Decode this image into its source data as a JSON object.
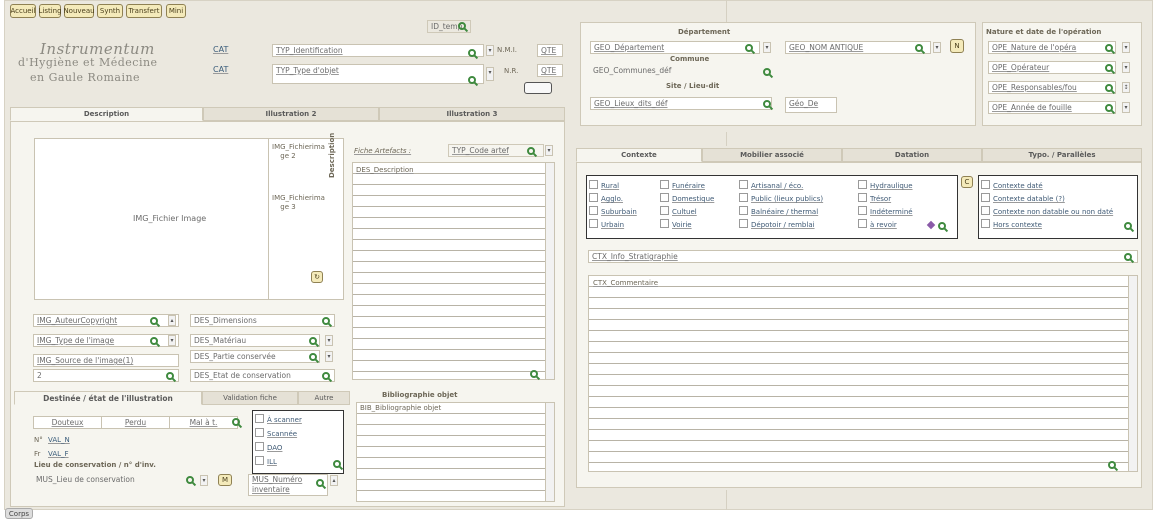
{
  "nav": [
    "Accueil",
    "Listing",
    "Nouveau",
    "Synth",
    "Transfert",
    "Mini"
  ],
  "search_id": "ID_temp",
  "brand": {
    "line1": "Instrumentum",
    "line2": "d'Hygiène et Médecine",
    "line3": "en Gaule Romaine"
  },
  "cat1": "CAT",
  "cat2": "CAT",
  "typ_ident": "TYP_Identification",
  "typ_type": "TYP_Type d'objet",
  "nmi_label": "N.M.I.",
  "nmi_value": "QTE",
  "nr_label": "N.R.",
  "nr_value": "QTE",
  "tabs_ill": [
    "Description",
    "Illustration 2",
    "Illustration 3"
  ],
  "image_placeholder": "IMG_Fichier Image",
  "img_page2": "IMG_Fichierima ge 2",
  "img_page3": "IMG_Fichierima ge 3",
  "desc_vertical": "Description",
  "fiche_label": "Fiche Artefacts :",
  "typ_code": "TYP_Code artef",
  "des_desc": "DES_Description",
  "img_author": "IMG_AuteurCopyright",
  "img_type": "IMG_Type de l'image",
  "img_source": "IMG_Source de l'image(1)",
  "img_source2": "2",
  "des_dim": "DES_Dimensions",
  "des_mat": "DES_Matériau",
  "des_part": "DES_Partie conservée",
  "des_etat": "DES_Etat de conservation",
  "tabs_dest": [
    "Destinée / état de l'illustration",
    "Validation fiche",
    "Autre"
  ],
  "dest_opts": [
    "Douteux",
    "Perdu",
    "Mal à t."
  ],
  "scan_opts": [
    "À scanner",
    "Scannée",
    "DAO",
    "ILL"
  ],
  "n_label": "N°",
  "val_n": "VAL_N",
  "fr_label": "Fr",
  "val_f": "VAL_F",
  "lieu_label": "Lieu de conservation / n° d'inv.",
  "mus_lieu": "MUS_Lieu de conservation",
  "mus_num": "MUS_Numéro",
  "mus_num2": "inventaire",
  "biblio_title": "Bibliographie objet",
  "biblio_field": "BIB_Bibliographie objet",
  "corps": "Corps",
  "dept_label": "Département",
  "geo_dept": "GEO_Département",
  "geo_nom": "GEO_NOM ANTIQUE",
  "commune_label": "Commune",
  "geo_commune": "GEO_Communes_déf",
  "site_label": "Site / Lieu-dit",
  "geo_lieux": "GEO_Lieux_dits_déf",
  "geo_de": "Géo_De",
  "nature_label": "Nature et date de l'opération",
  "ope_fields": [
    "OPE_Nature de l'opéra",
    "OPE_Opérateur",
    "OPE_Responsables/fou",
    "OPE_Année de fouille"
  ],
  "ctx_tabs": [
    "Contexte",
    "Mobilier associé",
    "Datation",
    "Typo. / Parallèles"
  ],
  "ctx_col1": [
    "Rural",
    "Agglo.",
    "Suburbain",
    "Urbain"
  ],
  "ctx_col2": [
    "Funéraire",
    "Domestique",
    "Cultuel",
    "Voirie"
  ],
  "ctx_col3": [
    "Artisanal / éco.",
    "Public (lieux publics)",
    "Balnéaire / thermal",
    "Dépotoir / remblai"
  ],
  "ctx_col4": [
    "Hydraulique",
    "Trésor",
    "Indéterminé",
    "à revoir"
  ],
  "ctx_date": [
    "Contexte daté",
    "Contexte datable (?)",
    "Contexte non datable ou non daté",
    "Hors contexte"
  ],
  "ctx_info": "CTX_Info_Stratigraphie",
  "ctx_comm": "CTX_Commentaire"
}
